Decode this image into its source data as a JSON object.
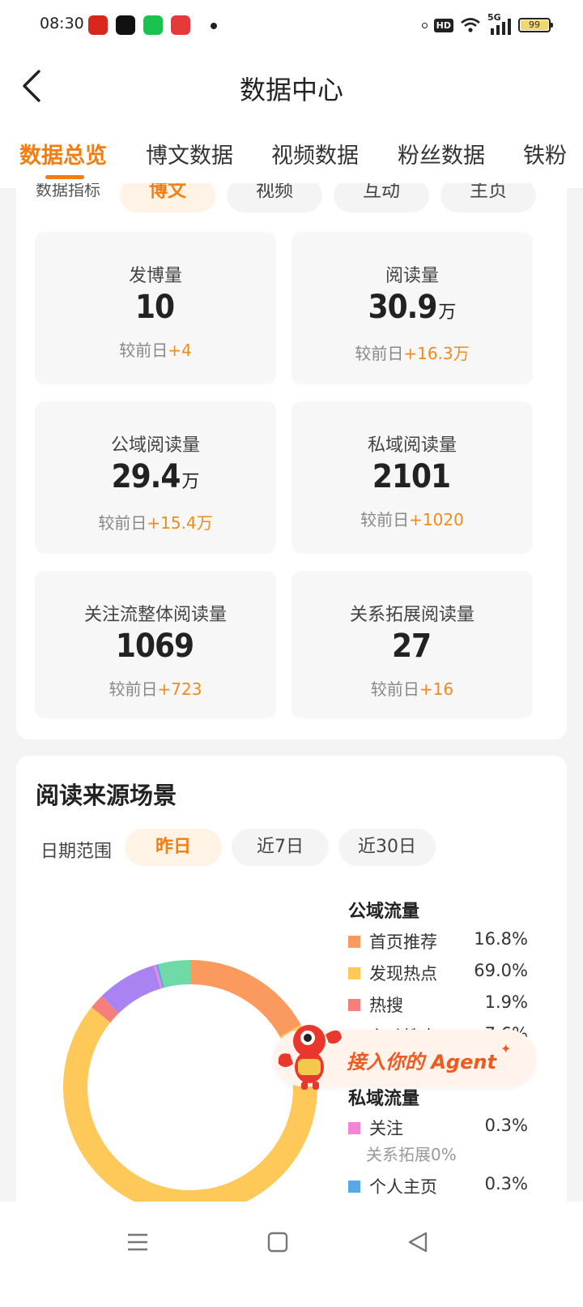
{
  "status_bar": {
    "time": "08:30",
    "network_label": "HD",
    "signal_label": "5G",
    "battery": "99"
  },
  "header": {
    "title": "数据中心",
    "back_icon": "chevron-left-icon"
  },
  "tabs": [
    {
      "label": "数据总览",
      "active": true
    },
    {
      "label": "博文数据",
      "active": false
    },
    {
      "label": "视频数据",
      "active": false
    },
    {
      "label": "粉丝数据",
      "active": false
    },
    {
      "label": "铁粉",
      "active": false
    }
  ],
  "indicators": {
    "label": "数据指标",
    "chips": [
      {
        "label": "博文",
        "active": true
      },
      {
        "label": "视频",
        "active": false
      },
      {
        "label": "互动",
        "active": false
      },
      {
        "label": "主页",
        "active": false
      }
    ]
  },
  "metrics": [
    {
      "label": "发博量",
      "value": "10",
      "unit": "",
      "compare_label": "较前日",
      "delta": "+4"
    },
    {
      "label": "阅读量",
      "value": "30.9",
      "unit": "万",
      "compare_label": "较前日",
      "delta": "+16.3万"
    },
    {
      "label": "公域阅读量",
      "value": "29.4",
      "unit": "万",
      "compare_label": "较前日",
      "delta": "+15.4万"
    },
    {
      "label": "私域阅读量",
      "value": "2101",
      "unit": "",
      "compare_label": "较前日",
      "delta": "+1020"
    },
    {
      "label": "关注流整体阅读量",
      "value": "1069",
      "unit": "",
      "compare_label": "较前日",
      "delta": "+723"
    },
    {
      "label": "关系拓展阅读量",
      "value": "27",
      "unit": "",
      "compare_label": "较前日",
      "delta": "+16"
    }
  ],
  "reading_sources": {
    "title": "阅读来源场景",
    "date_range_label": "日期范围",
    "date_options": [
      {
        "label": "昨日",
        "active": true
      },
      {
        "label": "近7日",
        "active": false
      },
      {
        "label": "近30日",
        "active": false
      }
    ],
    "public_title": "公域流量",
    "public_items": [
      {
        "name": "首页推荐",
        "pct": "16.8%",
        "color": "#fa9a5f",
        "value": 16.8
      },
      {
        "name": "发现热点",
        "pct": "69.0%",
        "color": "#ffc95a",
        "value": 69.0
      },
      {
        "name": "热搜",
        "pct": "1.9%",
        "color": "#f5807b",
        "value": 1.9
      },
      {
        "name": "主动搜索",
        "pct": "7.6%",
        "color": "#a983f1",
        "value": 7.6
      }
    ],
    "private_title": "私域流量",
    "private_items": [
      {
        "name": "关注",
        "pct": "0.3%",
        "color": "#f484d6",
        "value": 0.3
      },
      {
        "name": "个人主页",
        "pct": "0.3%",
        "color": "#5aa7e8",
        "value": 0.3
      }
    ],
    "relation_note": "关系拓展0%",
    "other_segment": {
      "color": "#6fd9a7",
      "value": 4.1
    }
  },
  "agent_banner": {
    "text": "接入你的 Agent"
  },
  "bottom_nav": {
    "menu_icon": "menu-icon",
    "home_icon": "home-square-icon",
    "back_icon": "back-triangle-icon"
  }
}
